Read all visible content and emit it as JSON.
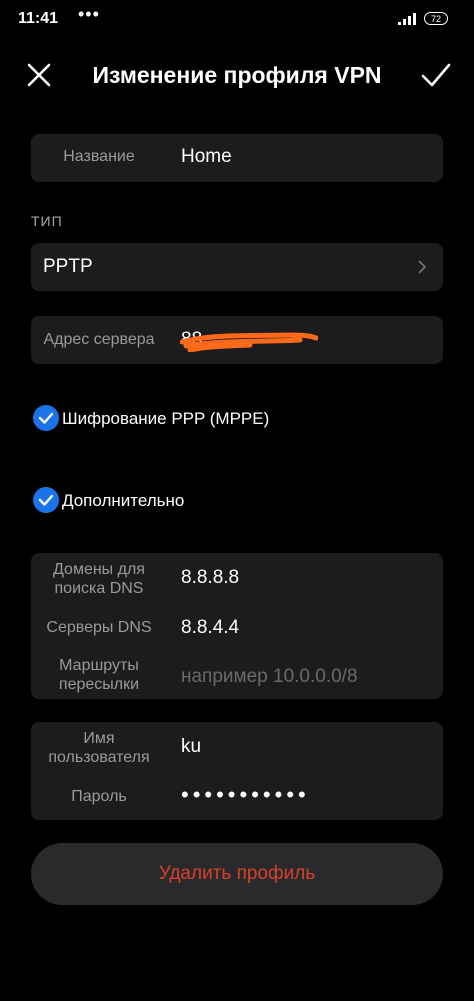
{
  "status": {
    "time": "11:41",
    "dots": "•••",
    "battery": "72"
  },
  "header": {
    "title": "Изменение профиля VPN"
  },
  "name_field": {
    "label": "Название",
    "value": "Home"
  },
  "type_section": {
    "label": "ТИП",
    "value": "PPTP"
  },
  "server_field": {
    "label": "Адрес сервера",
    "value": "88"
  },
  "options": {
    "encryption_label": "Шифрование PPP (MPPE)",
    "encryption_checked": true,
    "advanced_label": "Дополнительно",
    "advanced_checked": true
  },
  "advanced": {
    "dns_domains_label_1": "Домены для",
    "dns_domains_label_2": "поиска DNS",
    "dns_domains_value": "8.8.8.8",
    "dns_servers_label": "Серверы DNS",
    "dns_servers_value": "8.8.4.4",
    "routes_label_1": "Маршруты",
    "routes_label_2": "пересылки",
    "routes_placeholder": "например 10.0.0.0/8"
  },
  "credentials": {
    "username_label_1": "Имя",
    "username_label_2": "пользователя",
    "username_value": "ku",
    "password_label": "Пароль",
    "password_value": "•••••••••••"
  },
  "actions": {
    "delete_label": "Удалить профиль"
  },
  "colors": {
    "accent": "#1a73e8",
    "danger": "#d9402a",
    "card": "#1c1c1e",
    "redaction": "#ff6a1a"
  }
}
